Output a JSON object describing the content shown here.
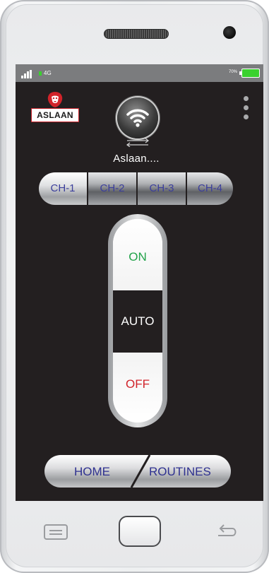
{
  "status_bar": {
    "network": "4G",
    "battery_text": "70%",
    "signal_icon": "signal-bars-icon",
    "battery_icon": "battery-icon"
  },
  "brand": {
    "logo_text": "ASLAAN",
    "logo_icon": "lion-head-icon"
  },
  "device": {
    "name": "Aslaan....",
    "icon": "wifi-icon"
  },
  "channels": [
    {
      "label": "CH-1",
      "active": true
    },
    {
      "label": "CH-2",
      "active": false
    },
    {
      "label": "CH-3",
      "active": false
    },
    {
      "label": "CH-4",
      "active": false
    }
  ],
  "mode_switch": {
    "on": "ON",
    "auto": "AUTO",
    "off": "OFF",
    "selected": "AUTO"
  },
  "bottom_nav": {
    "home": "HOME",
    "routines": "ROUTINES"
  },
  "colors": {
    "screen_bg": "#231f20",
    "label_blue": "#3c3f9c",
    "on_green": "#22a34a",
    "off_red": "#d1232a",
    "battery_green": "#3ad12e"
  }
}
